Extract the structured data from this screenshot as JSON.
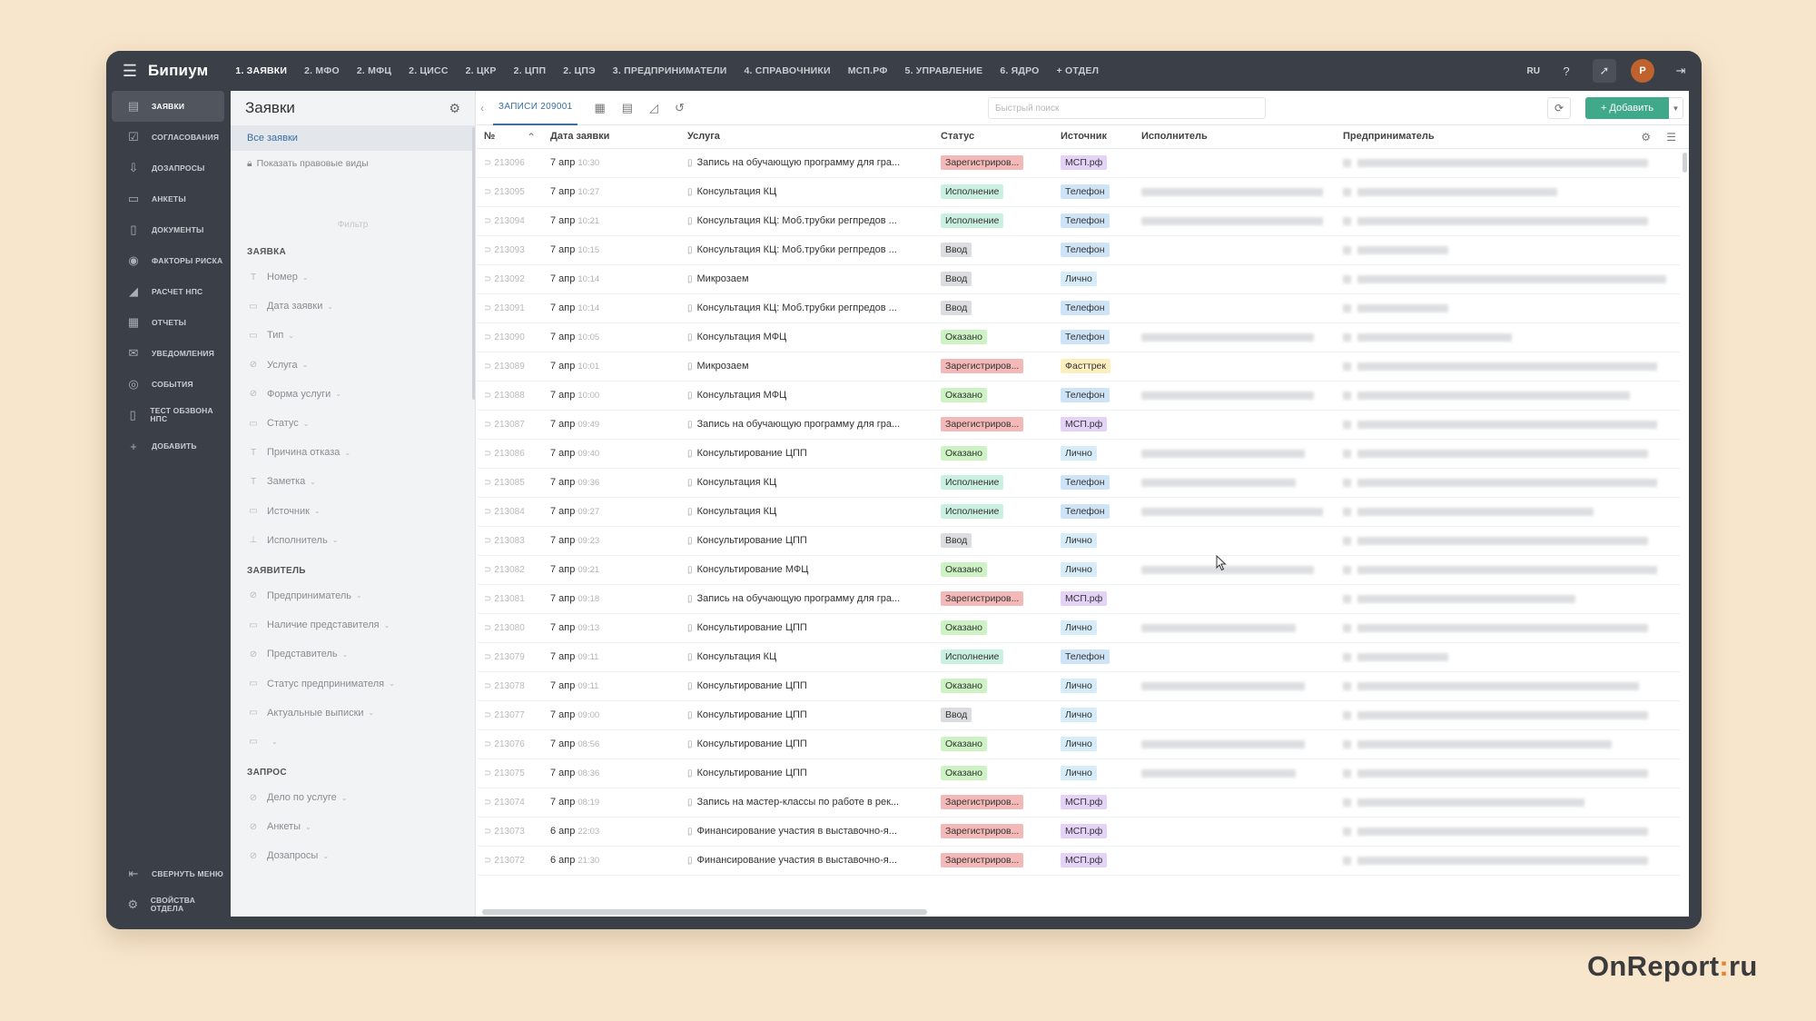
{
  "app": {
    "name": "Бипиум"
  },
  "topnav": [
    "1. ЗАЯВКИ",
    "2. МФО",
    "2. МФЦ",
    "2. ЦИСС",
    "2. ЦКР",
    "2. ЦПП",
    "2. ЦПЭ",
    "3. ПРЕДПРИНИМАТЕЛИ",
    "4. СПРАВОЧНИКИ",
    "МСП.РФ",
    "5. УПРАВЛЕНИЕ",
    "6. ЯДРО",
    "+ ОТДЕЛ"
  ],
  "topright": {
    "lang": "RU",
    "avatar": "Р"
  },
  "rail": [
    {
      "label": "ЗАЯВКИ",
      "icon": "table-icon",
      "active": true
    },
    {
      "label": "СОГЛАСОВАНИЯ",
      "icon": "checklist-icon"
    },
    {
      "label": "ДОЗАПРОСЫ",
      "icon": "inbox-icon"
    },
    {
      "label": "АНКЕТЫ",
      "icon": "form-icon"
    },
    {
      "label": "ДОКУМЕНТЫ",
      "icon": "document-icon"
    },
    {
      "label": "ФАКТОРЫ РИСКА",
      "icon": "warning-icon"
    },
    {
      "label": "РАСЧЕТ НПС",
      "icon": "chart-icon"
    },
    {
      "label": "ОТЧЕТЫ",
      "icon": "report-icon"
    },
    {
      "label": "УВЕДОМЛЕНИЯ",
      "icon": "mail-icon"
    },
    {
      "label": "СОБЫТИЯ",
      "icon": "event-icon"
    },
    {
      "label": "ТЕСТ ОБЗВОНА НПС",
      "icon": "phone-icon"
    },
    {
      "label": "ДОБАВИТЬ",
      "icon": "plus-icon"
    }
  ],
  "rail_bottom": [
    {
      "label": "СВЕРНУТЬ МЕНЮ",
      "icon": "collapse-icon"
    },
    {
      "label": "СВОЙСТВА ОТДЕЛА",
      "icon": "gear-icon"
    }
  ],
  "filters": {
    "title": "Заявки",
    "all": "Все заявки",
    "show_rights": "Показать правовые виды",
    "filter_label": "Фильтр",
    "sections": [
      {
        "title": "ЗАЯВКА",
        "items": [
          "Номер",
          "Дата заявки",
          "Тип",
          "Услуга",
          "Форма услуги",
          "Статус",
          "Причина отказа",
          "Заметка",
          "Источник",
          "Исполнитель"
        ]
      },
      {
        "title": "ЗАЯВИТЕЛЬ",
        "items": [
          "Предприниматель",
          "Наличие представителя",
          "Представитель",
          "Статус предпринимателя",
          "Актуальные выписки",
          ""
        ]
      },
      {
        "title": "ЗАПРОС",
        "items": [
          "Дело по услуге",
          "Анкеты",
          "Дозапросы"
        ]
      }
    ]
  },
  "toolbar": {
    "tab": "ЗАПИСИ 209001",
    "search_placeholder": "Быстрый поиск",
    "add": "+ Добавить"
  },
  "columns": {
    "no": "№",
    "date": "Дата заявки",
    "service": "Услуга",
    "status": "Статус",
    "source": "Источник",
    "executor": "Исполнитель",
    "entrepreneur": "Предприниматель"
  },
  "colors": {
    "status": {
      "Зарегистриров...": "#f3b8b8",
      "Исполнение": "#c9f0e0",
      "Ввод": "#dcdde0",
      "Оказано": "#cdf2c4"
    },
    "source": {
      "МСП.рф": "#e4d2f7",
      "Телефон": "#cfe3f7",
      "Лично": "#d6ecf8",
      "Фасттрек": "#fbeebf"
    }
  },
  "rows": [
    {
      "id": "213096",
      "date": "7 апр",
      "time": "10:30",
      "service": "Запись на обучающую программу для гра...",
      "status": "Зарегистриров...",
      "source": "МСП.рф",
      "exec": false
    },
    {
      "id": "213095",
      "date": "7 апр",
      "time": "10:27",
      "service": "Консультация КЦ",
      "status": "Исполнение",
      "source": "Телефон",
      "exec": true
    },
    {
      "id": "213094",
      "date": "7 апр",
      "time": "10:21",
      "service": "Консультация КЦ: Моб.трубки регпредов ...",
      "status": "Исполнение",
      "source": "Телефон",
      "exec": true
    },
    {
      "id": "213093",
      "date": "7 апр",
      "time": "10:15",
      "service": "Консультация КЦ: Моб.трубки регпредов ...",
      "status": "Ввод",
      "source": "Телефон",
      "exec": false
    },
    {
      "id": "213092",
      "date": "7 апр",
      "time": "10:14",
      "service": "Микрозаем",
      "status": "Ввод",
      "source": "Лично",
      "exec": false
    },
    {
      "id": "213091",
      "date": "7 апр",
      "time": "10:14",
      "service": "Консультация КЦ: Моб.трубки регпредов ...",
      "status": "Ввод",
      "source": "Телефон",
      "exec": false
    },
    {
      "id": "213090",
      "date": "7 апр",
      "time": "10:05",
      "service": "Консультация МФЦ",
      "status": "Оказано",
      "source": "Телефон",
      "exec": true
    },
    {
      "id": "213089",
      "date": "7 апр",
      "time": "10:01",
      "service": "Микрозаем",
      "status": "Зарегистриров...",
      "source": "Фасттрек",
      "exec": false
    },
    {
      "id": "213088",
      "date": "7 апр",
      "time": "10:00",
      "service": "Консультация МФЦ",
      "status": "Оказано",
      "source": "Телефон",
      "exec": true
    },
    {
      "id": "213087",
      "date": "7 апр",
      "time": "09:49",
      "service": "Запись на обучающую программу для гра...",
      "status": "Зарегистриров...",
      "source": "МСП.рф",
      "exec": false
    },
    {
      "id": "213086",
      "date": "7 апр",
      "time": "09:40",
      "service": "Консультирование ЦПП",
      "status": "Оказано",
      "source": "Лично",
      "exec": true
    },
    {
      "id": "213085",
      "date": "7 апр",
      "time": "09:36",
      "service": "Консультация КЦ",
      "status": "Исполнение",
      "source": "Телефон",
      "exec": true
    },
    {
      "id": "213084",
      "date": "7 апр",
      "time": "09:27",
      "service": "Консультация КЦ",
      "status": "Исполнение",
      "source": "Телефон",
      "exec": true
    },
    {
      "id": "213083",
      "date": "7 апр",
      "time": "09:23",
      "service": "Консультирование ЦПП",
      "status": "Ввод",
      "source": "Лично",
      "exec": false
    },
    {
      "id": "213082",
      "date": "7 апр",
      "time": "09:21",
      "service": "Консультирование МФЦ",
      "status": "Оказано",
      "source": "Лично",
      "exec": true
    },
    {
      "id": "213081",
      "date": "7 апр",
      "time": "09:18",
      "service": "Запись на обучающую программу для гра...",
      "status": "Зарегистриров...",
      "source": "МСП.рф",
      "exec": false
    },
    {
      "id": "213080",
      "date": "7 апр",
      "time": "09:13",
      "service": "Консультирование ЦПП",
      "status": "Оказано",
      "source": "Лично",
      "exec": true
    },
    {
      "id": "213079",
      "date": "7 апр",
      "time": "09:11",
      "service": "Консультация КЦ",
      "status": "Исполнение",
      "source": "Телефон",
      "exec": false
    },
    {
      "id": "213078",
      "date": "7 апр",
      "time": "09:11",
      "service": "Консультирование ЦПП",
      "status": "Оказано",
      "source": "Лично",
      "exec": true
    },
    {
      "id": "213077",
      "date": "7 апр",
      "time": "09:00",
      "service": "Консультирование ЦПП",
      "status": "Ввод",
      "source": "Лично",
      "exec": false
    },
    {
      "id": "213076",
      "date": "7 апр",
      "time": "08:56",
      "service": "Консультирование ЦПП",
      "status": "Оказано",
      "source": "Лично",
      "exec": true
    },
    {
      "id": "213075",
      "date": "7 апр",
      "time": "08:36",
      "service": "Консультирование ЦПП",
      "status": "Оказано",
      "source": "Лично",
      "exec": true
    },
    {
      "id": "213074",
      "date": "7 апр",
      "time": "08:19",
      "service": "Запись на мастер-классы по работе в рек...",
      "status": "Зарегистриров...",
      "source": "МСП.рф",
      "exec": false
    },
    {
      "id": "213073",
      "date": "6 апр",
      "time": "22:03",
      "service": "Финансирование участия в выставочно-я...",
      "status": "Зарегистриров...",
      "source": "МСП.рф",
      "exec": false
    },
    {
      "id": "213072",
      "date": "6 апр",
      "time": "21:30",
      "service": "Финансирование участия в выставочно-я...",
      "status": "Зарегистриров...",
      "source": "МСП.рф",
      "exec": false
    }
  ],
  "watermark": {
    "left": "OnReport",
    "dot": ":",
    "right": "ru"
  }
}
